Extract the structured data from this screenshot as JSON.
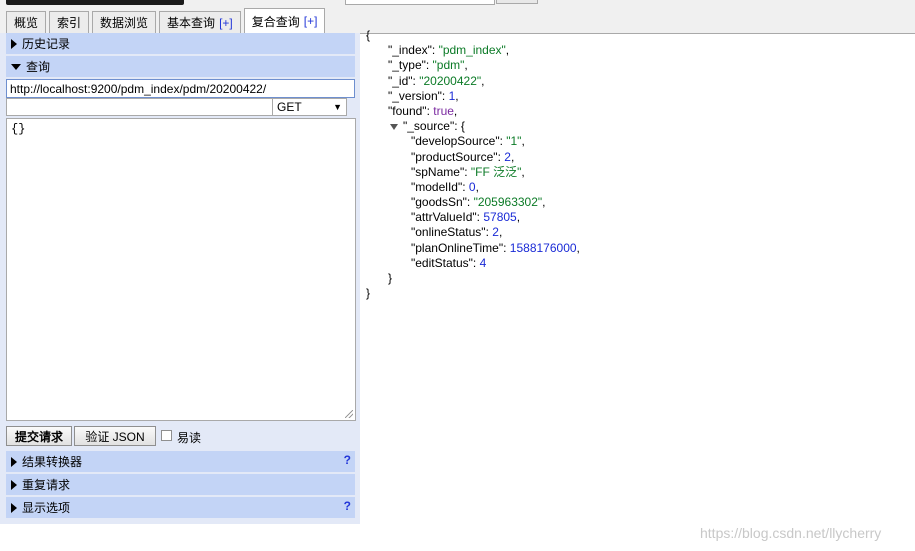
{
  "tabs": [
    {
      "label": "概览",
      "plus": ""
    },
    {
      "label": "索引",
      "plus": ""
    },
    {
      "label": "数据浏览",
      "plus": ""
    },
    {
      "label": "基本查询",
      "plus": "[+]"
    },
    {
      "label": "复合查询",
      "plus": "[+]"
    }
  ],
  "sections": {
    "history": "历史记录",
    "query": "查询",
    "transformer": "结果转换器",
    "repeat": "重复请求",
    "display": "显示选项",
    "help": "?"
  },
  "request": {
    "url": "http://localhost:9200/pdm_index/pdm/20200422/",
    "path": "",
    "method": "GET",
    "body": "{}",
    "submit_label": "提交请求",
    "validate_label": "验证 JSON",
    "easy_read_label": "易读"
  },
  "json_lines": [
    "{",
    "\"_index\": \"pdm_index\",",
    "\"_type\": \"pdm\",",
    "\"_id\": \"20200422\",",
    "\"_version\": 1,",
    "\"found\": true,",
    "\"_source\": {",
    "\"developSource\": \"1\",",
    "\"productSource\": 2,",
    "\"spName\": \"FF 泛泛\",",
    "\"modelId\": 0,",
    "\"goodsSn\": \"205963302\",",
    "\"attrValueId\": 57805,",
    "\"onlineStatus\": 2,",
    "\"planOnlineTime\": 1588176000,",
    "\"editStatus\": 4",
    "}",
    "}"
  ],
  "watermark": "https://blog.csdn.net/llycherry",
  "colors": {
    "header_blue": "#c3d4f6",
    "panel_bg": "#e3e9f7",
    "string": "#0b7a26",
    "number": "#1a2bd6",
    "boolean": "#7b2aa0"
  }
}
